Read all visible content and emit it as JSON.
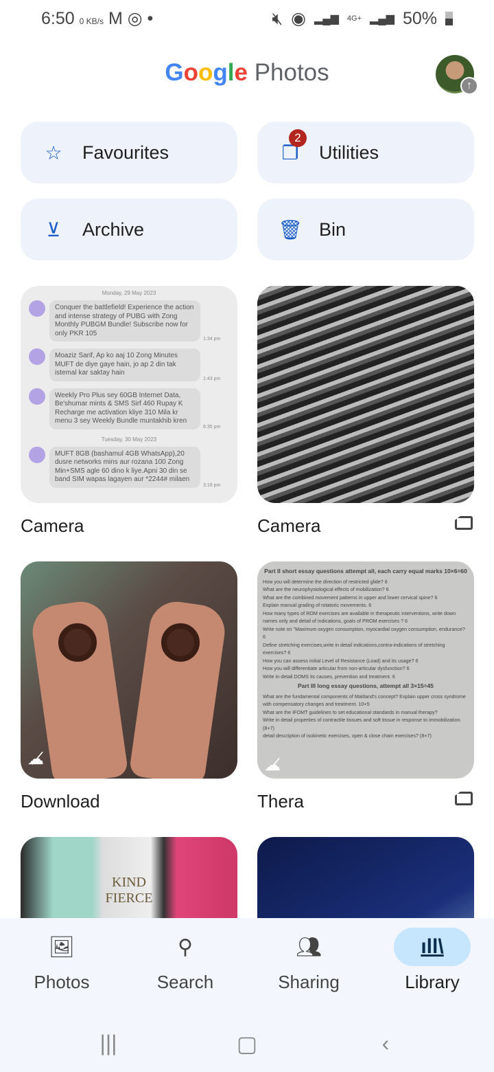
{
  "status_bar": {
    "time": "6:50",
    "net_speed": "0",
    "net_unit": "KB/s",
    "signal": "4G+",
    "battery": "50%"
  },
  "header": {
    "logo_google": [
      "G",
      "o",
      "o",
      "g",
      "l",
      "e"
    ],
    "logo_colors": [
      "#4285f4",
      "#ea4335",
      "#fbbc05",
      "#4285f4",
      "#34a853",
      "#ea4335"
    ],
    "product": "Photos"
  },
  "quick_actions": [
    {
      "label": "Favourites",
      "icon": "star-icon"
    },
    {
      "label": "Utilities",
      "icon": "utilities-icon",
      "badge": "2"
    },
    {
      "label": "Archive",
      "icon": "archive-icon"
    },
    {
      "label": "Bin",
      "icon": "trash-icon"
    }
  ],
  "albums": [
    {
      "label": "Camera"
    },
    {
      "label": "Camera",
      "icon": "sd-card-icon"
    },
    {
      "label": "Download",
      "icon": "cloud-off-icon"
    },
    {
      "label": "Thera",
      "icon": "sd-card-icon"
    }
  ],
  "sms_thumb": {
    "date1": "Monday, 29 May 2023",
    "messages": [
      {
        "text": "Conquer the battlefield! Experience the action and intense strategy of PUBG with Zong Monthly PUBGM Bundle! Subscribe now for only PKR 105",
        "time": "1:34 pm"
      },
      {
        "text": "Moaziz Sarif, Ap ko aaj 10 Zong Minutes MUFT de diye gaye hain, jo ap 2 din tak istemal kar saktay hain",
        "time": "1:43 pm"
      },
      {
        "text": "Weekly Pro Plus sey 60GB Internet Data, Be'shumar mints & SMS Sirf 460 Rupay K Recharge me activation kliye 310 Mila kr menu 3 sey Weekly Bundle muntakhib kren",
        "time": "6:35 pm"
      }
    ],
    "date2": "Tuesday, 30 May 2023",
    "message_last": {
      "text": "MUFT 8GB (bashamul 4GB WhatsApp),20 dusre networks mins aur rozana 100 Zong Min+SMS agle 60 dino k liye.Apni 30 din se band SIM wapas lagayen aur *2244# milaen",
      "time": "3:16 pm"
    }
  },
  "paper_thumb": {
    "heading1": "Part II short essay questions attempt all, each carry equal marks 10×6=60",
    "lines": [
      "How you will determine the direction of restricted glide? 6",
      "What are the neurophysiological effects of mobilization? 6",
      "What are the combined movement patterns in upper and lower cervical spine? 6",
      "Explain manual grading of rotatoric movements. 6",
      "How many types of ROM exercises are available in therapeutic interventions, write down names only and detail of indications, goals of PROM exercises ? 6",
      "Write note on \"Maximum oxygen consumption, myocardial oxygen consumption, endurance? 6",
      "Define stretching exercises,write in detail indications,contra-indications of stretching exercises? 6",
      "How you can assess initial Level of Resistance (Load) and its usage? 6",
      "How you will differentiate articular from non-articular dysfunction? 6",
      "Write in detail DOMS its causes, prevention and treatment. 6"
    ],
    "heading2": "Part III long essay questions, attempt all 3×15=45",
    "lines2": [
      "What are the fundamental components of Maitland's concept? Explain upper cross syndrome with compensatory changes and treatment. 10+5",
      "What are the IFOMT guidelines to set educational standards in manual therapy?",
      "Write in detail properties of contractile tissues and soft tissue in response to immobilization. (8+7)",
      "detail description of isokinetic exercises, open & close chain exercises? (8+7)"
    ]
  },
  "bottle_thumb": {
    "words": [
      "KIND",
      "FIERCE"
    ]
  },
  "bottom_nav": {
    "items": [
      {
        "label": "Photos",
        "icon": "photo-icon"
      },
      {
        "label": "Search",
        "icon": "search-icon"
      },
      {
        "label": "Sharing",
        "icon": "people-icon"
      },
      {
        "label": "Library",
        "icon": "library-icon",
        "active": true
      }
    ]
  },
  "colors": {
    "accent": "#1b5fc6",
    "badge": "#b3261e",
    "card_bg": "#eef2fb",
    "active_pill": "#c5e6fc"
  }
}
